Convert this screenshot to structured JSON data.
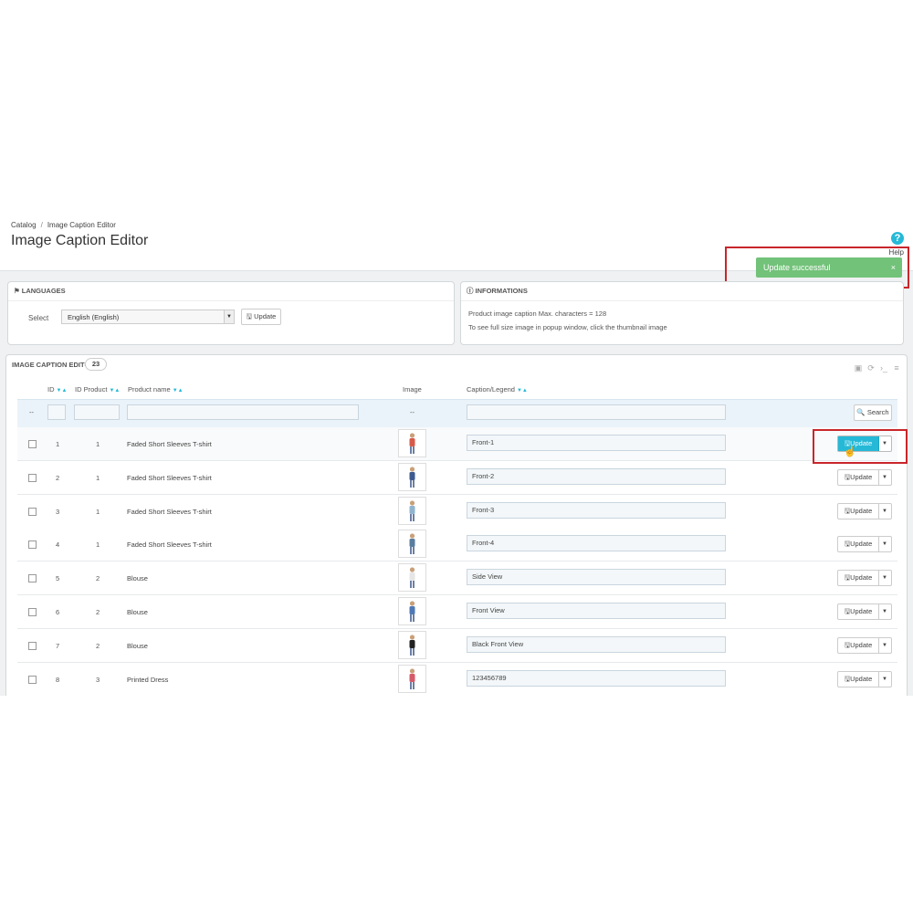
{
  "breadcrumb": {
    "parent": "Catalog",
    "separator": "/",
    "current": "Image Caption Editor"
  },
  "page_title": "Image Caption Editor",
  "help": {
    "label": "Help",
    "icon": "help-icon"
  },
  "toast": {
    "message": "Update successful",
    "close": "×"
  },
  "languages_panel": {
    "title": "LANGUAGES",
    "select_label": "Select",
    "selected_language": "English (English)",
    "update_label": "Update"
  },
  "info_panel": {
    "title": "INFORMATIONS",
    "line1": "Product image caption Max. characters = 128",
    "line2": "To see full size image in popup window, click the thumbnail image"
  },
  "table": {
    "title": "IMAGE CAPTION EDITOR",
    "count": "23",
    "columns": {
      "id": "ID",
      "id_product": "ID Product",
      "product_name": "Product name",
      "image": "Image",
      "caption": "Caption/Legend"
    },
    "filter": {
      "dash1": "--",
      "dash2": "--",
      "search_label": "Search"
    },
    "update_label": "Update",
    "rows": [
      {
        "id": "1",
        "id_product": "1",
        "name": "Faded Short Sleeves T-shirt",
        "caption": "Front-1"
      },
      {
        "id": "2",
        "id_product": "1",
        "name": "Faded Short Sleeves T-shirt",
        "caption": "Front-2"
      },
      {
        "id": "3",
        "id_product": "1",
        "name": "Faded Short Sleeves T-shirt",
        "caption": "Front-3"
      },
      {
        "id": "4",
        "id_product": "1",
        "name": "Faded Short Sleeves T-shirt",
        "caption": "Front-4"
      },
      {
        "id": "5",
        "id_product": "2",
        "name": "Blouse",
        "caption": "Side View"
      },
      {
        "id": "6",
        "id_product": "2",
        "name": "Blouse",
        "caption": "Front View"
      },
      {
        "id": "7",
        "id_product": "2",
        "name": "Blouse",
        "caption": "Black Front View"
      },
      {
        "id": "8",
        "id_product": "3",
        "name": "Printed Dress",
        "caption": "123456789"
      }
    ]
  },
  "colors": {
    "accent": "#25b9d7",
    "success": "#72c279",
    "highlight": "#c8262b"
  }
}
